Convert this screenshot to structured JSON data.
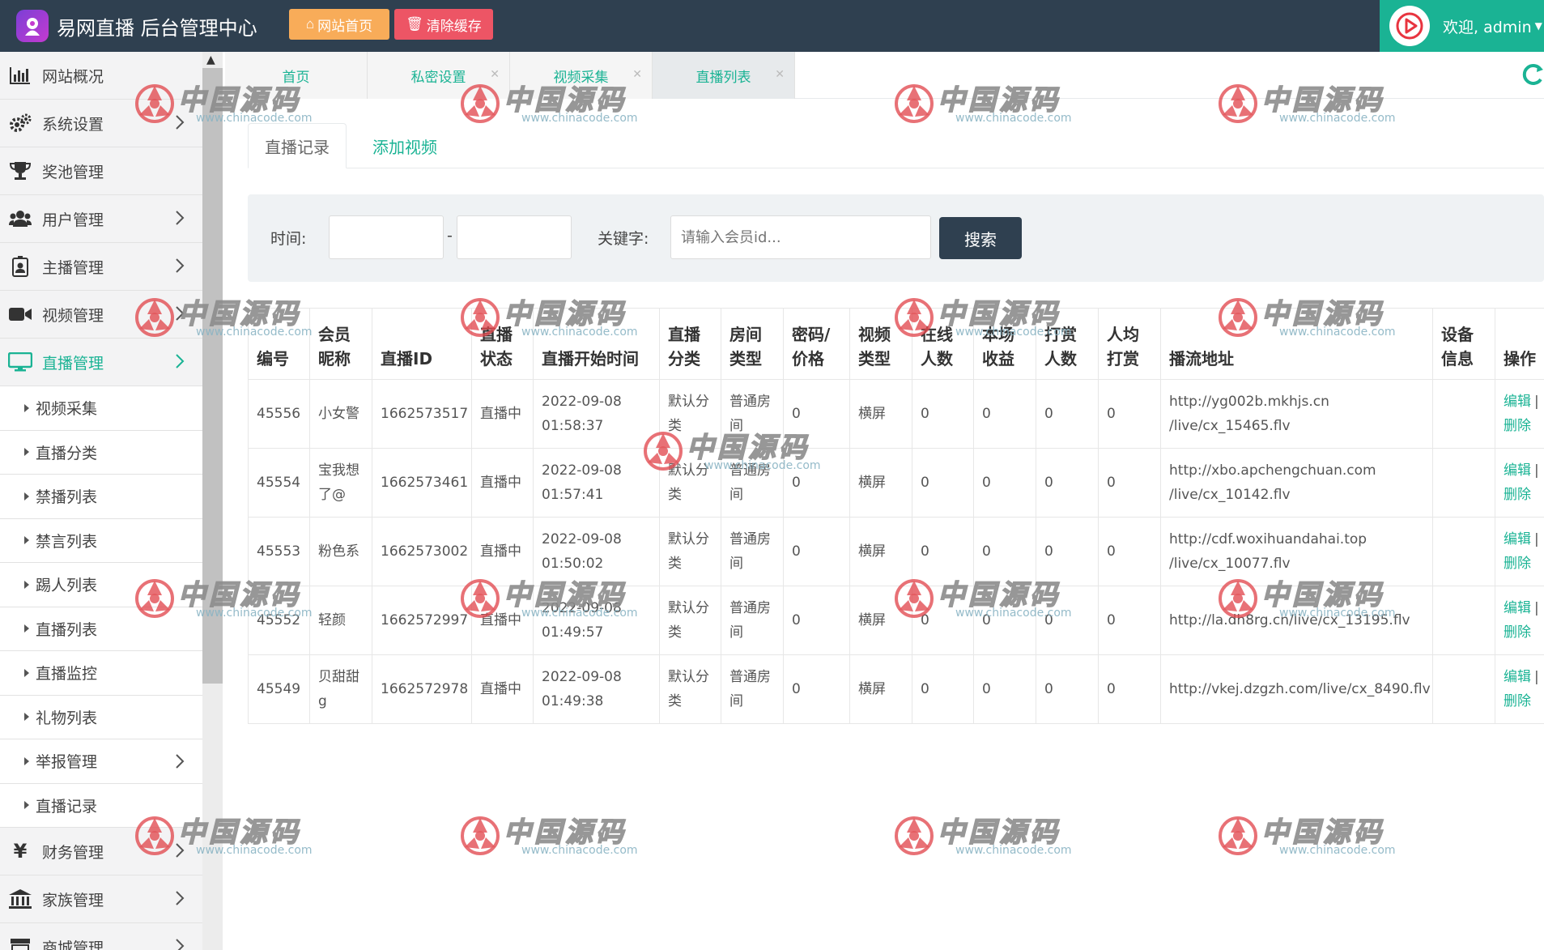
{
  "header": {
    "title": "易网直播 后台管理中心",
    "home_btn": "网站首页",
    "clear_btn": "清除缓存",
    "welcome": "欢迎, admin"
  },
  "sidebar": {
    "items": [
      {
        "label": "网站概况",
        "icon": "bar-chart-icon",
        "chevron": false
      },
      {
        "label": "系统设置",
        "icon": "cogs-icon",
        "chevron": true
      },
      {
        "label": "奖池管理",
        "icon": "trophy-icon",
        "chevron": false
      },
      {
        "label": "用户管理",
        "icon": "users-icon",
        "chevron": true
      },
      {
        "label": "主播管理",
        "icon": "id-badge-icon",
        "chevron": true
      },
      {
        "label": "视频管理",
        "icon": "video-camera-icon",
        "chevron": true
      },
      {
        "label": "直播管理",
        "icon": "desktop-icon",
        "chevron": true,
        "active": true
      }
    ],
    "sub_items": [
      "视频采集",
      "直播分类",
      "禁播列表",
      "禁言列表",
      "踢人列表",
      "直播列表",
      "直播监控",
      "礼物列表",
      "举报管理",
      "直播记录"
    ],
    "bottom_items": [
      {
        "label": "财务管理",
        "icon": "yen-icon"
      },
      {
        "label": "家族管理",
        "icon": "bank-icon"
      },
      {
        "label": "商城管理",
        "icon": "shop-icon"
      }
    ]
  },
  "page_tabs": [
    {
      "label": "首页"
    },
    {
      "label": "私密设置"
    },
    {
      "label": "视频采集"
    },
    {
      "label": "直播列表",
      "active": true
    }
  ],
  "sub_tabs": {
    "active": "直播记录",
    "other": "添加视频"
  },
  "filter": {
    "time_label": "时间:",
    "dash": "-",
    "keyword_label": "关键字:",
    "keyword_placeholder": "请输入会员id...",
    "search_btn": "搜索"
  },
  "table": {
    "headers": [
      "编号",
      "会员昵称",
      "直播ID",
      "直播状态",
      "直播开始时间",
      "直播分类",
      "房间类型",
      "密码/价格",
      "视频类型",
      "在线人数",
      "本场收益",
      "打赏人数",
      "人均打赏",
      "播流地址",
      "设备信息",
      "操作"
    ],
    "rows": [
      {
        "id": "45556",
        "nick": "小女警",
        "liveid": "1662573517",
        "status": "直播中",
        "start": "2022-09-08 01:58:37",
        "cat": "默认分类",
        "room": "普通房间",
        "pwd": "0",
        "vtype": "横屏",
        "online": "0",
        "income": "0",
        "tippers": "0",
        "avg": "0",
        "url": "http://yg002b.mkhjs.cn /live/cx_15465.flv",
        "device": ""
      },
      {
        "id": "45554",
        "nick": "宝我想了@",
        "liveid": "1662573461",
        "status": "直播中",
        "start": "2022-09-08 01:57:41",
        "cat": "默认分类",
        "room": "普通房间",
        "pwd": "0",
        "vtype": "横屏",
        "online": "0",
        "income": "0",
        "tippers": "0",
        "avg": "0",
        "url": "http://xbo.apchengchuan.com /live/cx_10142.flv",
        "device": ""
      },
      {
        "id": "45553",
        "nick": "粉色系",
        "liveid": "1662573002",
        "status": "直播中",
        "start": "2022-09-08 01:50:02",
        "cat": "默认分类",
        "room": "普通房间",
        "pwd": "0",
        "vtype": "横屏",
        "online": "0",
        "income": "0",
        "tippers": "0",
        "avg": "0",
        "url": "http://cdf.woxihuandahai.top /live/cx_10077.flv",
        "device": ""
      },
      {
        "id": "45552",
        "nick": "轻颜",
        "liveid": "1662572997",
        "status": "直播中",
        "start": "2022-09-08 01:49:57",
        "cat": "默认分类",
        "room": "普通房间",
        "pwd": "0",
        "vtype": "横屏",
        "online": "0",
        "income": "0",
        "tippers": "0",
        "avg": "0",
        "url": "http://la.dh8rg.cn/live/cx_13195.flv",
        "device": ""
      },
      {
        "id": "45549",
        "nick": "贝甜甜g",
        "liveid": "1662572978",
        "status": "直播中",
        "start": "2022-09-08 01:49:38",
        "cat": "默认分类",
        "room": "普通房间",
        "pwd": "0",
        "vtype": "横屏",
        "online": "0",
        "income": "0",
        "tippers": "0",
        "avg": "0",
        "url": "http://vkej.dzgzh.com/live/cx_8490.flv",
        "device": ""
      }
    ],
    "op_edit": "编辑",
    "op_sep": "|",
    "op_delete": "删除"
  },
  "watermark": {
    "text": "中国源码",
    "url": "www.chinacode.com"
  },
  "colors": {
    "header_bg": "#2f4050",
    "accent": "#1ab394",
    "orange": "#f8ac59",
    "red": "#ed5565"
  }
}
